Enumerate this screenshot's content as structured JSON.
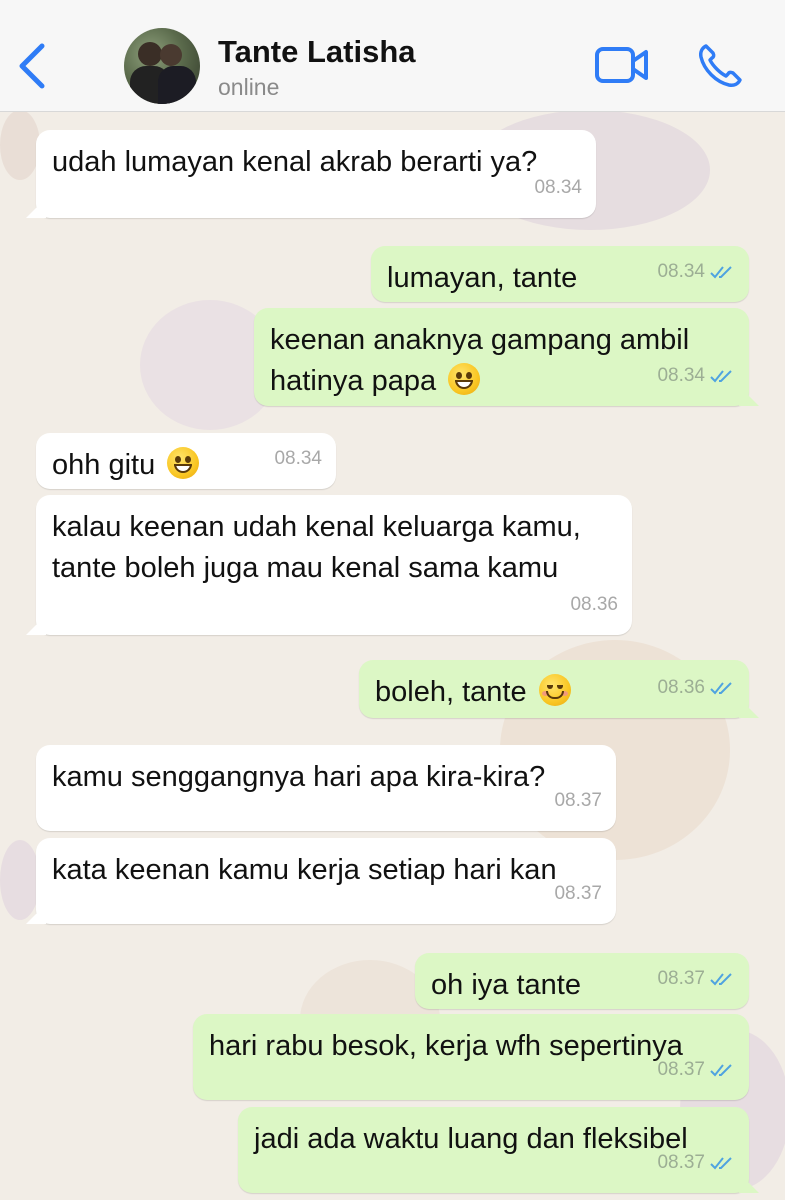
{
  "header": {
    "contact_name": "Tante Latisha",
    "contact_status": "online",
    "accent_color": "#2f7cf6"
  },
  "messages": [
    {
      "direction": "in",
      "text": "udah lumayan kenal akrab berarti ya?",
      "time": "08.34"
    },
    {
      "direction": "out",
      "text": "lumayan, tante",
      "time": "08.34",
      "read": true
    },
    {
      "direction": "out",
      "text": "keenan anaknya gampang ambil hatinya papa",
      "emoji": "grinning-face-icon",
      "time": "08.34",
      "read": true
    },
    {
      "direction": "in",
      "text": "ohh gitu",
      "emoji": "grinning-face-icon",
      "time": "08.34"
    },
    {
      "direction": "in",
      "text": "kalau keenan udah kenal keluarga kamu, tante boleh juga mau kenal sama kamu",
      "time": "08.36"
    },
    {
      "direction": "out",
      "text": "boleh, tante",
      "emoji": "smiling-face-icon",
      "time": "08.36",
      "read": true
    },
    {
      "direction": "in",
      "text": "kamu senggangnya hari apa kira-kira?",
      "time": "08.37"
    },
    {
      "direction": "in",
      "text": "kata keenan kamu kerja setiap hari kan",
      "time": "08.37"
    },
    {
      "direction": "out",
      "text": "oh iya tante",
      "time": "08.37",
      "read": true
    },
    {
      "direction": "out",
      "text": "hari rabu besok, kerja wfh sepertinya",
      "time": "08.37",
      "read": true
    },
    {
      "direction": "out",
      "text": "jadi ada waktu luang dan fleksibel",
      "time": "08.37",
      "read": true
    }
  ],
  "colors": {
    "incoming_bubble": "#ffffff",
    "outgoing_bubble": "#dcf7c5",
    "read_ticks": "#4fa3e0"
  }
}
